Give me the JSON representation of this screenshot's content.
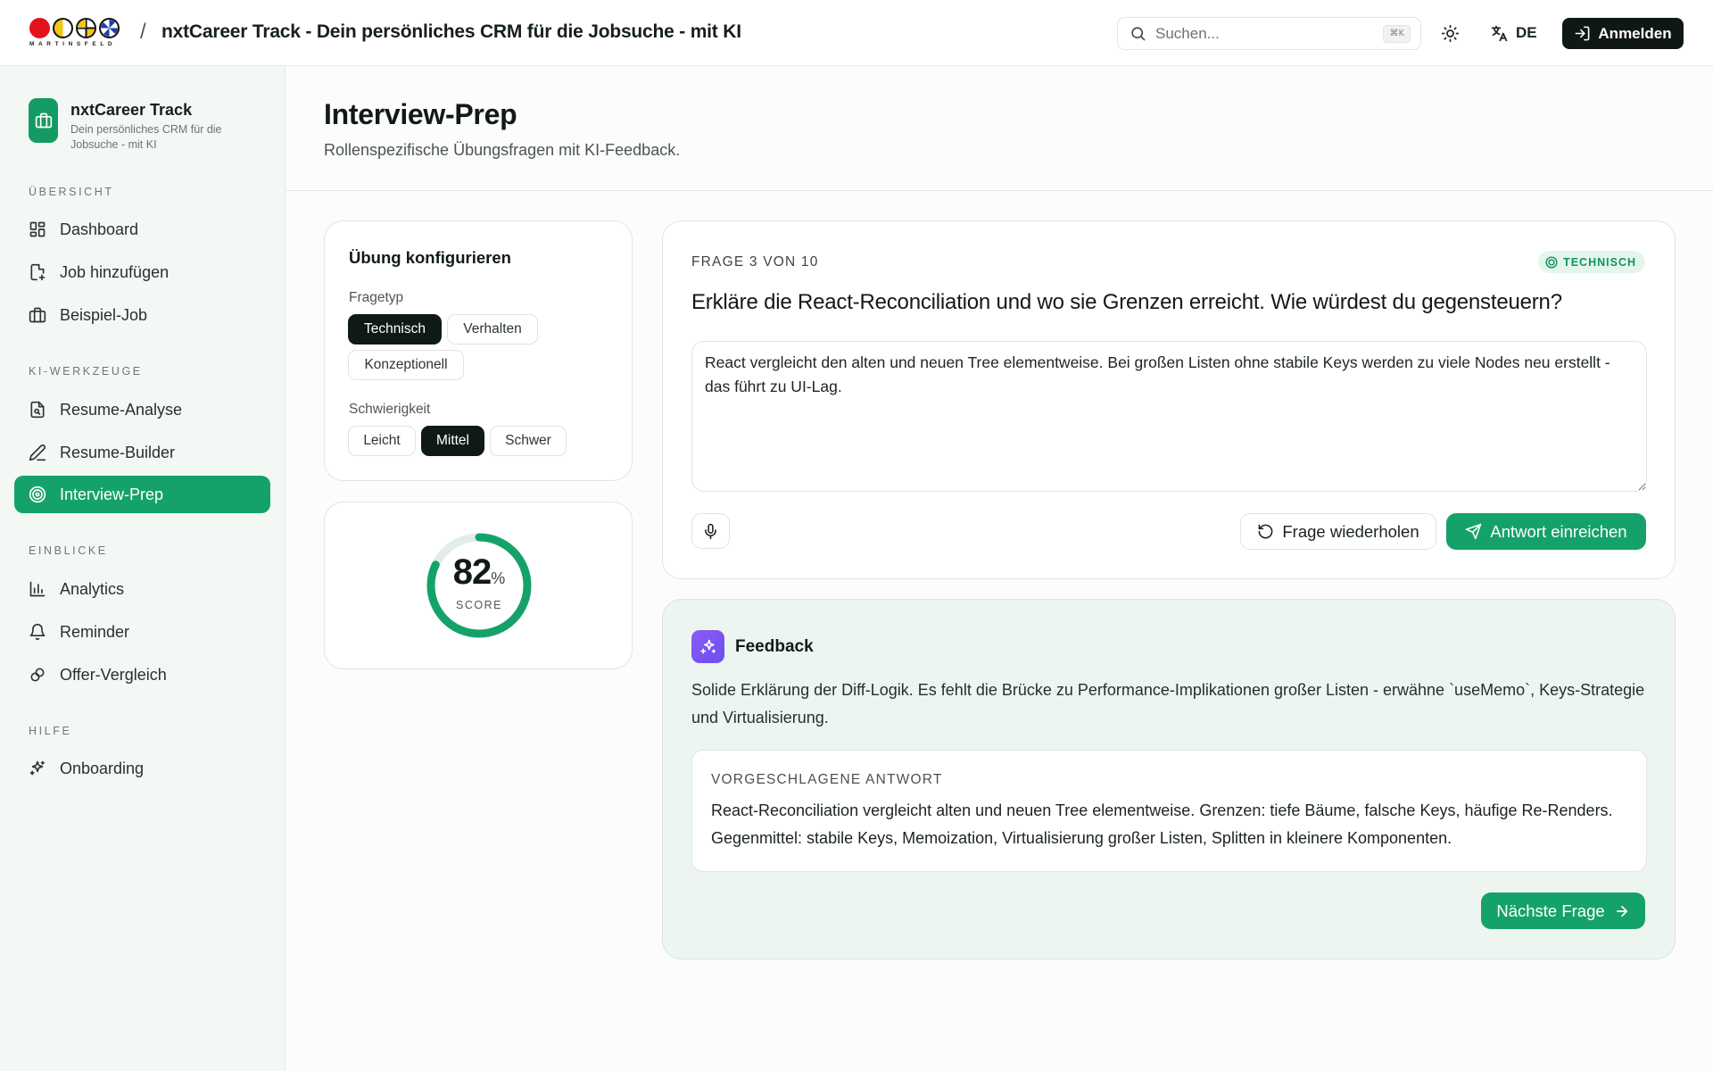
{
  "header": {
    "logo_word": "MARTINSFELD",
    "separator": "/",
    "title": "nxtCareer Track - Dein persönliches CRM für die Jobsuche - mit KI",
    "search_placeholder": "Suchen...",
    "search_value": "",
    "search_shortcut": "⌘K",
    "language": "DE",
    "login_label": "Anmelden"
  },
  "sidebar": {
    "brand_name": "nxtCareer Track",
    "brand_desc": "Dein persönliches CRM für die Jobsuche - mit KI",
    "sections": [
      {
        "title": "ÜBERSICHT",
        "items": [
          {
            "label": "Dashboard",
            "icon": "dashboard-icon"
          },
          {
            "label": "Job hinzufügen",
            "icon": "file-plus-icon"
          },
          {
            "label": "Beispiel-Job",
            "icon": "briefcase-icon"
          }
        ]
      },
      {
        "title": "KI-WERKZEUGE",
        "items": [
          {
            "label": "Resume-Analyse",
            "icon": "file-search-icon"
          },
          {
            "label": "Resume-Builder",
            "icon": "pen-icon"
          },
          {
            "label": "Interview-Prep",
            "icon": "target-icon",
            "active": true
          }
        ]
      },
      {
        "title": "EINBLICKE",
        "items": [
          {
            "label": "Analytics",
            "icon": "bar-chart-icon"
          },
          {
            "label": "Reminder",
            "icon": "bell-icon"
          },
          {
            "label": "Offer-Vergleich",
            "icon": "link-icon"
          }
        ]
      },
      {
        "title": "HILFE",
        "items": [
          {
            "label": "Onboarding",
            "icon": "sparkles-icon"
          }
        ]
      }
    ]
  },
  "page": {
    "title": "Interview-Prep",
    "subtitle": "Rollenspezifische Übungsfragen mit KI-Feedback."
  },
  "config": {
    "title": "Übung konfigurieren",
    "type_label": "Fragetyp",
    "types": [
      "Technisch",
      "Verhalten",
      "Konzeptionell"
    ],
    "selected_type": "Technisch",
    "difficulty_label": "Schwierigkeit",
    "difficulties": [
      "Leicht",
      "Mittel",
      "Schwer"
    ],
    "selected_difficulty": "Mittel"
  },
  "score": {
    "value": "82",
    "percent_value": 82,
    "unit": "%",
    "label": "SCORE"
  },
  "question": {
    "counter": "FRAGE 3 VON 10",
    "tag": "TECHNISCH",
    "text": "Erkläre die React-Reconciliation und wo sie Grenzen erreicht. Wie würdest du gegensteuern?",
    "answer": "React vergleicht den alten und neuen Tree elementweise. Bei großen Listen ohne stabile Keys werden zu viele Nodes neu erstellt - das führt zu UI-Lag.",
    "repeat_label": "Frage wiederholen",
    "submit_label": "Antwort einreichen"
  },
  "feedback": {
    "title": "Feedback",
    "text": "Solide Erklärung der Diff-Logik. Es fehlt die Brücke zu Performance-Implikationen großer Listen - erwähne `useMemo`, Keys-Strategie und Virtualisierung.",
    "suggested_label": "VORGESCHLAGENE ANTWORT",
    "suggested_text": "React-Reconciliation vergleicht alten und neuen Tree elementweise. Grenzen: tiefe Bäume, falsche Keys, häufige Re-Renders. Gegenmittel: stabile Keys, Memoization, Virtualisierung großer Listen, Splitten in kleinere Komponenten.",
    "next_label": "Nächste Frage"
  },
  "colors": {
    "accent": "#15a26a",
    "dark": "#0f1a15",
    "feedback_bg": "#edf5f1",
    "ring_track": "#e3ece8"
  }
}
